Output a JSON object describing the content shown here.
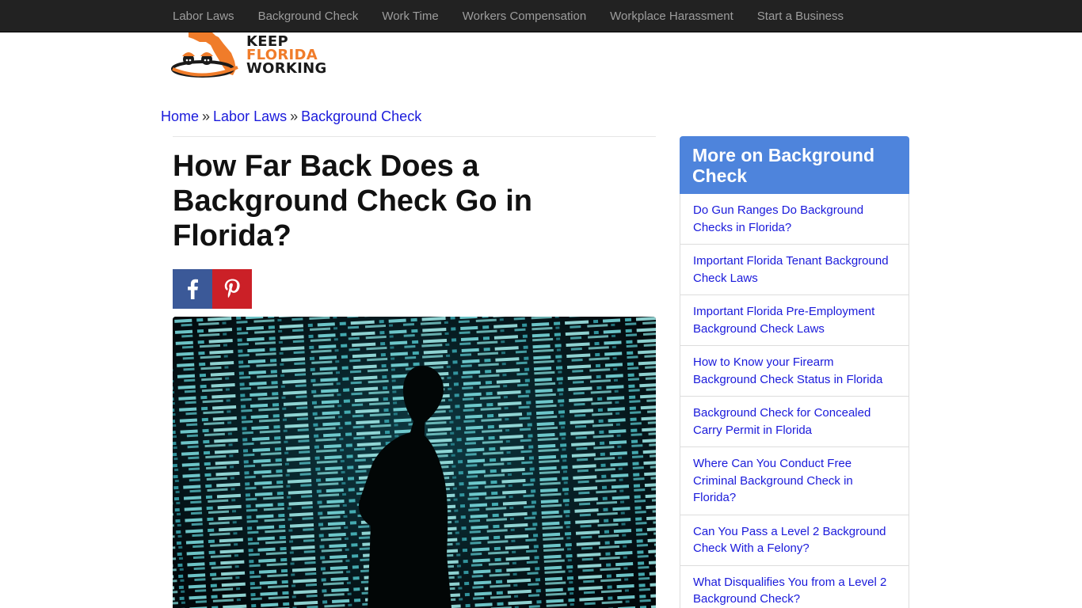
{
  "nav": {
    "items": [
      "Labor Laws",
      "Background Check",
      "Work Time",
      "Workers Compensation",
      "Workplace Harassment",
      "Start a Business"
    ]
  },
  "logo": {
    "line1": "KEEP",
    "line2": "FLORIDA",
    "line3": "WORKING",
    "accent": "#f07c2a"
  },
  "breadcrumb": {
    "home": "Home",
    "sep": "»",
    "section": "Labor Laws",
    "current": "Background Check"
  },
  "article": {
    "title": "How Far Back Does a Background Check Go in Florida?"
  },
  "share": {
    "facebook": "facebook-icon",
    "pinterest": "pinterest-icon"
  },
  "sidebar": {
    "heading": "More on Background Check",
    "links": [
      "Do Gun Ranges Do Background Checks in Florida?",
      "Important Florida Tenant Background Check Laws",
      "Important Florida Pre-Employment Background Check Laws",
      "How to Know your Firearm Background Check Status in Florida",
      "Background Check for Concealed Carry Permit in Florida",
      "Where Can You Conduct Free Criminal Background Check in Florida?",
      "Can You Pass a Level 2 Background Check With a Felony?",
      "What Disqualifies You from a Level 2 Background Check?"
    ]
  },
  "colors": {
    "nav_bg": "#222222",
    "nav_text": "#9d9d9d",
    "link": "#1a1adb",
    "sidebar_head": "#4e84dc",
    "facebook": "#3b5998",
    "pinterest": "#cb2027"
  }
}
